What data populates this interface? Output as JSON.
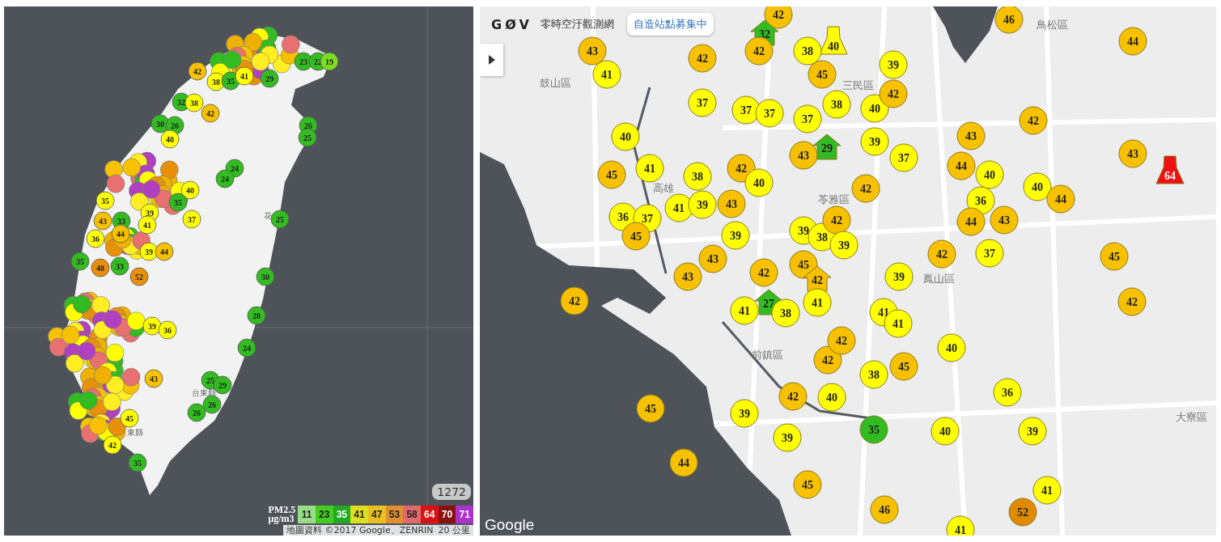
{
  "left_map": {
    "place_labels": [
      "花",
      "台東縣",
      "東縣"
    ],
    "markers": [
      {
        "value": "23",
        "color": "#33bb22"
      },
      {
        "value": "22",
        "color": "#33bb22"
      },
      {
        "value": "19",
        "color": "#7ddc1f"
      },
      {
        "value": "42",
        "color": "#f7c100"
      },
      {
        "value": "38",
        "color": "#ffff00"
      },
      {
        "value": "35",
        "color": "#33bb22"
      },
      {
        "value": "41",
        "color": "#ffff00"
      },
      {
        "value": "29",
        "color": "#33bb22"
      },
      {
        "value": "32",
        "color": "#33bb22"
      },
      {
        "value": "38",
        "color": "#ffff00"
      },
      {
        "value": "30",
        "color": "#33bb22"
      },
      {
        "value": "26",
        "color": "#33bb22"
      },
      {
        "value": "42",
        "color": "#f7c100"
      },
      {
        "value": "26",
        "color": "#33bb22"
      },
      {
        "value": "40",
        "color": "#ffff00"
      },
      {
        "value": "25",
        "color": "#33bb22"
      },
      {
        "value": "24",
        "color": "#33bb22"
      },
      {
        "value": "40",
        "color": "#ffff00"
      },
      {
        "value": "24",
        "color": "#33bb22"
      },
      {
        "value": "35",
        "color": "#ffff00"
      },
      {
        "value": "35",
        "color": "#33bb22"
      },
      {
        "value": "43",
        "color": "#f7c100"
      },
      {
        "value": "33",
        "color": "#33bb22"
      },
      {
        "value": "39",
        "color": "#ffff00"
      },
      {
        "value": "41",
        "color": "#ffff00"
      },
      {
        "value": "37",
        "color": "#ffff00"
      },
      {
        "value": "25",
        "color": "#33bb22"
      },
      {
        "value": "36",
        "color": "#ffff00"
      },
      {
        "value": "44",
        "color": "#f7c100"
      },
      {
        "value": "35",
        "color": "#33bb22"
      },
      {
        "value": "48",
        "color": "#e8900a"
      },
      {
        "value": "33",
        "color": "#33bb22"
      },
      {
        "value": "39",
        "color": "#ffff00"
      },
      {
        "value": "44",
        "color": "#f7c100"
      },
      {
        "value": "52",
        "color": "#e8900a"
      },
      {
        "value": "30",
        "color": "#33bb22"
      },
      {
        "value": "28",
        "color": "#33bb22"
      },
      {
        "value": "39",
        "color": "#ffff00"
      },
      {
        "value": "36",
        "color": "#ffff00"
      },
      {
        "value": "24",
        "color": "#33bb22"
      },
      {
        "value": "43",
        "color": "#f7c100"
      },
      {
        "value": "25",
        "color": "#33bb22"
      },
      {
        "value": "29",
        "color": "#33bb22"
      },
      {
        "value": "45",
        "color": "#ffff00"
      },
      {
        "value": "26",
        "color": "#33bb22"
      },
      {
        "value": "26",
        "color": "#33bb22"
      },
      {
        "value": "42",
        "color": "#ffff00"
      },
      {
        "value": "35",
        "color": "#33bb22"
      }
    ],
    "station_count": "1272",
    "legend": {
      "title": "PM2.5",
      "unit": "μg/m3",
      "items": [
        {
          "label": "11",
          "color": "#99dd88"
        },
        {
          "label": "23",
          "color": "#44cc22"
        },
        {
          "label": "35",
          "color": "#22aa22"
        },
        {
          "label": "41",
          "color": "#dddd22"
        },
        {
          "label": "47",
          "color": "#e8c020"
        },
        {
          "label": "53",
          "color": "#e09030"
        },
        {
          "label": "58",
          "color": "#e06a6a"
        },
        {
          "label": "64",
          "color": "#dd1111"
        },
        {
          "label": "70",
          "color": "#881111"
        },
        {
          "label": "71",
          "color": "#aa33cc"
        }
      ]
    },
    "attribution": "地圖資料 ©2017 Google、ZENRIN",
    "scale": "20 公里"
  },
  "right_map": {
    "logo": "GØV",
    "site_title": "零時空汙觀測網",
    "badge": "自造站點募集中",
    "google": "Google",
    "place_labels": [
      "鼓山區",
      "三民區",
      "鳥松區",
      "苓雅區",
      "高雄",
      "鳳山區",
      "前鎮區",
      "大寮區"
    ],
    "markers": [
      {
        "value": "42",
        "color": "#f7c100",
        "kind": "circle"
      },
      {
        "value": "46",
        "color": "#f7c100",
        "kind": "circle"
      },
      {
        "value": "32",
        "color": "#33bb22",
        "kind": "house"
      },
      {
        "value": "40",
        "color": "#ffff00",
        "kind": "factory"
      },
      {
        "value": "44",
        "color": "#f7c100",
        "kind": "circle"
      },
      {
        "value": "43",
        "color": "#f7c100",
        "kind": "circle"
      },
      {
        "value": "41",
        "color": "#ffff00",
        "kind": "circle"
      },
      {
        "value": "42",
        "color": "#f7c100",
        "kind": "circle"
      },
      {
        "value": "42",
        "color": "#f7c100",
        "kind": "circle"
      },
      {
        "value": "38",
        "color": "#ffff00",
        "kind": "circle"
      },
      {
        "value": "45",
        "color": "#f7c100",
        "kind": "circle"
      },
      {
        "value": "39",
        "color": "#ffff00",
        "kind": "circle"
      },
      {
        "value": "37",
        "color": "#ffff00",
        "kind": "circle"
      },
      {
        "value": "37",
        "color": "#ffff00",
        "kind": "circle"
      },
      {
        "value": "37",
        "color": "#ffff00",
        "kind": "circle"
      },
      {
        "value": "37",
        "color": "#ffff00",
        "kind": "circle"
      },
      {
        "value": "38",
        "color": "#ffff00",
        "kind": "circle"
      },
      {
        "value": "40",
        "color": "#ffff00",
        "kind": "circle"
      },
      {
        "value": "42",
        "color": "#f7c100",
        "kind": "circle"
      },
      {
        "value": "42",
        "color": "#f7c100",
        "kind": "circle"
      },
      {
        "value": "40",
        "color": "#ffff00",
        "kind": "circle"
      },
      {
        "value": "39",
        "color": "#ffff00",
        "kind": "circle"
      },
      {
        "value": "43",
        "color": "#f7c100",
        "kind": "circle"
      },
      {
        "value": "45",
        "color": "#f7c100",
        "kind": "circle"
      },
      {
        "value": "41",
        "color": "#ffff00",
        "kind": "circle"
      },
      {
        "value": "38",
        "color": "#ffff00",
        "kind": "circle"
      },
      {
        "value": "42",
        "color": "#f7c100",
        "kind": "circle"
      },
      {
        "value": "40",
        "color": "#ffff00",
        "kind": "circle"
      },
      {
        "value": "43",
        "color": "#f7c100",
        "kind": "circle"
      },
      {
        "value": "29",
        "color": "#33bb22",
        "kind": "house"
      },
      {
        "value": "42",
        "color": "#f7c100",
        "kind": "circle"
      },
      {
        "value": "37",
        "color": "#ffff00",
        "kind": "circle"
      },
      {
        "value": "44",
        "color": "#f7c100",
        "kind": "circle"
      },
      {
        "value": "40",
        "color": "#ffff00",
        "kind": "circle"
      },
      {
        "value": "40",
        "color": "#ffff00",
        "kind": "circle"
      },
      {
        "value": "43",
        "color": "#f7c100",
        "kind": "circle"
      },
      {
        "value": "64",
        "color": "#ee1111",
        "kind": "factory"
      },
      {
        "value": "36",
        "color": "#ffff00",
        "kind": "circle"
      },
      {
        "value": "37",
        "color": "#ffff00",
        "kind": "circle"
      },
      {
        "value": "41",
        "color": "#ffff00",
        "kind": "circle"
      },
      {
        "value": "39",
        "color": "#ffff00",
        "kind": "circle"
      },
      {
        "value": "43",
        "color": "#f7c100",
        "kind": "circle"
      },
      {
        "value": "36",
        "color": "#ffff00",
        "kind": "circle"
      },
      {
        "value": "44",
        "color": "#f7c100",
        "kind": "circle"
      },
      {
        "value": "45",
        "color": "#f7c100",
        "kind": "circle"
      },
      {
        "value": "39",
        "color": "#ffff00",
        "kind": "circle"
      },
      {
        "value": "39",
        "color": "#ffff00",
        "kind": "circle"
      },
      {
        "value": "38",
        "color": "#ffff00",
        "kind": "circle"
      },
      {
        "value": "42",
        "color": "#f7c100",
        "kind": "circle"
      },
      {
        "value": "44",
        "color": "#f7c100",
        "kind": "circle"
      },
      {
        "value": "43",
        "color": "#f7c100",
        "kind": "circle"
      },
      {
        "value": "43",
        "color": "#f7c100",
        "kind": "circle"
      },
      {
        "value": "43",
        "color": "#f7c100",
        "kind": "circle"
      },
      {
        "value": "42",
        "color": "#f7c100",
        "kind": "circle"
      },
      {
        "value": "45",
        "color": "#f7c100",
        "kind": "circle"
      },
      {
        "value": "42",
        "color": "#f7c100",
        "kind": "house"
      },
      {
        "value": "39",
        "color": "#ffff00",
        "kind": "circle"
      },
      {
        "value": "39",
        "color": "#ffff00",
        "kind": "circle"
      },
      {
        "value": "42",
        "color": "#f7c100",
        "kind": "circle"
      },
      {
        "value": "37",
        "color": "#ffff00",
        "kind": "circle"
      },
      {
        "value": "45",
        "color": "#f7c100",
        "kind": "circle"
      },
      {
        "value": "42",
        "color": "#f7c100",
        "kind": "circle"
      },
      {
        "value": "41",
        "color": "#ffff00",
        "kind": "circle"
      },
      {
        "value": "27",
        "color": "#33bb22",
        "kind": "house"
      },
      {
        "value": "38",
        "color": "#ffff00",
        "kind": "circle"
      },
      {
        "value": "41",
        "color": "#ffff00",
        "kind": "circle"
      },
      {
        "value": "41",
        "color": "#ffff00",
        "kind": "circle"
      },
      {
        "value": "41",
        "color": "#ffff00",
        "kind": "circle"
      },
      {
        "value": "42",
        "color": "#f7c100",
        "kind": "circle"
      },
      {
        "value": "42",
        "color": "#f7c100",
        "kind": "circle"
      },
      {
        "value": "42",
        "color": "#f7c100",
        "kind": "circle"
      },
      {
        "value": "40",
        "color": "#ffff00",
        "kind": "circle"
      },
      {
        "value": "38",
        "color": "#ffff00",
        "kind": "circle"
      },
      {
        "value": "45",
        "color": "#f7c100",
        "kind": "circle"
      },
      {
        "value": "45",
        "color": "#f7c100",
        "kind": "circle"
      },
      {
        "value": "39",
        "color": "#ffff00",
        "kind": "circle"
      },
      {
        "value": "39",
        "color": "#ffff00",
        "kind": "circle"
      },
      {
        "value": "42",
        "color": "#f7c100",
        "kind": "circle"
      },
      {
        "value": "40",
        "color": "#ffff00",
        "kind": "circle"
      },
      {
        "value": "35",
        "color": "#33bb22",
        "kind": "circle"
      },
      {
        "value": "40",
        "color": "#ffff00",
        "kind": "circle"
      },
      {
        "value": "36",
        "color": "#ffff00",
        "kind": "circle"
      },
      {
        "value": "39",
        "color": "#ffff00",
        "kind": "circle"
      },
      {
        "value": "44",
        "color": "#f7c100",
        "kind": "circle"
      },
      {
        "value": "45",
        "color": "#f7c100",
        "kind": "circle"
      },
      {
        "value": "46",
        "color": "#f7c100",
        "kind": "circle"
      },
      {
        "value": "41",
        "color": "#ffff00",
        "kind": "circle"
      },
      {
        "value": "52",
        "color": "#e08a00",
        "kind": "circle"
      },
      {
        "value": "41",
        "color": "#ffff00",
        "kind": "circle"
      }
    ]
  }
}
